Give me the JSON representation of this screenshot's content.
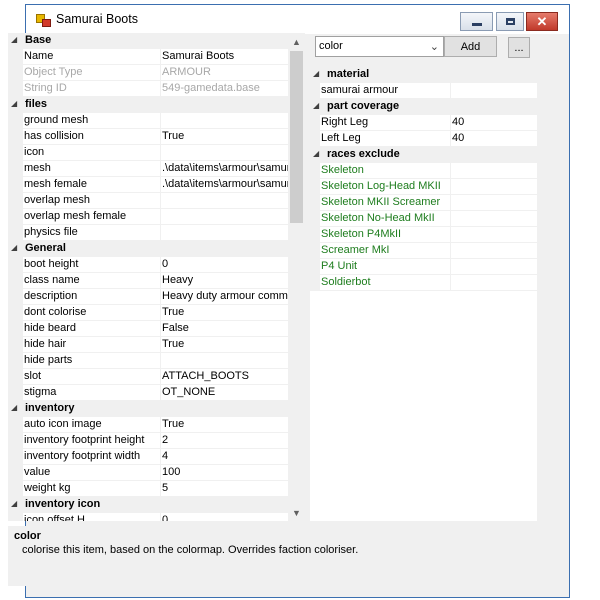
{
  "window": {
    "title": "Samurai Boots"
  },
  "property_grid": {
    "rows": [
      {
        "type": "category",
        "label": "Base"
      },
      {
        "type": "prop",
        "name": "Name",
        "value": "Samurai Boots"
      },
      {
        "type": "prop",
        "name": "Object Type",
        "value": "ARMOUR",
        "disabled": true
      },
      {
        "type": "prop",
        "name": "String ID",
        "value": "549-gamedata.base",
        "disabled": true
      },
      {
        "type": "category",
        "label": "files"
      },
      {
        "type": "prop",
        "name": "ground mesh",
        "value": ""
      },
      {
        "type": "prop",
        "name": "has collision",
        "value": "True"
      },
      {
        "type": "prop",
        "name": "icon",
        "value": ""
      },
      {
        "type": "prop",
        "name": "mesh",
        "value": ".\\data\\items\\armour\\samur"
      },
      {
        "type": "prop",
        "name": "mesh female",
        "value": ".\\data\\items\\armour\\samur"
      },
      {
        "type": "prop",
        "name": "overlap mesh",
        "value": ""
      },
      {
        "type": "prop",
        "name": "overlap mesh female",
        "value": ""
      },
      {
        "type": "prop",
        "name": "physics file",
        "value": ""
      },
      {
        "type": "category",
        "label": "General"
      },
      {
        "type": "prop",
        "name": "boot height",
        "value": "0"
      },
      {
        "type": "prop",
        "name": "class name",
        "value": "Heavy"
      },
      {
        "type": "prop",
        "name": "description",
        "value": "Heavy duty armour commor"
      },
      {
        "type": "prop",
        "name": "dont colorise",
        "value": "True"
      },
      {
        "type": "prop",
        "name": "hide beard",
        "value": "False"
      },
      {
        "type": "prop",
        "name": "hide hair",
        "value": "True"
      },
      {
        "type": "prop",
        "name": "hide parts",
        "value": ""
      },
      {
        "type": "prop",
        "name": "slot",
        "value": "ATTACH_BOOTS"
      },
      {
        "type": "prop",
        "name": "stigma",
        "value": "OT_NONE"
      },
      {
        "type": "category",
        "label": "inventory"
      },
      {
        "type": "prop",
        "name": "auto icon image",
        "value": "True"
      },
      {
        "type": "prop",
        "name": "inventory footprint height",
        "value": "2"
      },
      {
        "type": "prop",
        "name": "inventory footprint width",
        "value": "4"
      },
      {
        "type": "prop",
        "name": "value",
        "value": "100"
      },
      {
        "type": "prop",
        "name": "weight kg",
        "value": "5"
      },
      {
        "type": "category",
        "label": "inventory icon"
      },
      {
        "type": "prop",
        "name": "icon offset H",
        "value": "0"
      }
    ]
  },
  "toolbar": {
    "combo_value": "color",
    "add_label": "Add",
    "more_label": "..."
  },
  "references": {
    "rows": [
      {
        "type": "category",
        "label": "material"
      },
      {
        "type": "item",
        "name": "samurai armour",
        "value": ""
      },
      {
        "type": "category",
        "label": "part coverage"
      },
      {
        "type": "item",
        "name": "Right Leg",
        "value": "40"
      },
      {
        "type": "item",
        "name": "Left Leg",
        "value": "40"
      },
      {
        "type": "category",
        "label": "races exclude"
      },
      {
        "type": "item",
        "name": "Skeleton",
        "value": "",
        "green": true
      },
      {
        "type": "item",
        "name": "Skeleton Log-Head MKII",
        "value": "",
        "green": true
      },
      {
        "type": "item",
        "name": "Skeleton MKII Screamer",
        "value": "",
        "green": true
      },
      {
        "type": "item",
        "name": "Skeleton No-Head MkII",
        "value": "",
        "green": true
      },
      {
        "type": "item",
        "name": "Skeleton P4MkII",
        "value": "",
        "green": true
      },
      {
        "type": "item",
        "name": "Screamer MkI",
        "value": "",
        "green": true
      },
      {
        "type": "item",
        "name": "P4 Unit",
        "value": "",
        "green": true
      },
      {
        "type": "item",
        "name": "Soldierbot",
        "value": "",
        "green": true
      }
    ]
  },
  "description_panel": {
    "title": "color",
    "text": "colorise this item, based on the colormap. Overrides faction coloriser."
  },
  "icons": [
    "app-icon",
    "minimize-icon",
    "maximize-icon",
    "close-icon",
    "chevron-down-icon",
    "collapse-icon",
    "scroll-up-icon",
    "scroll-down-icon"
  ],
  "colors": {
    "reference_green": "#1e7d1e",
    "disabled_text": "#a8a8a8",
    "close_red": "#c0392b"
  }
}
